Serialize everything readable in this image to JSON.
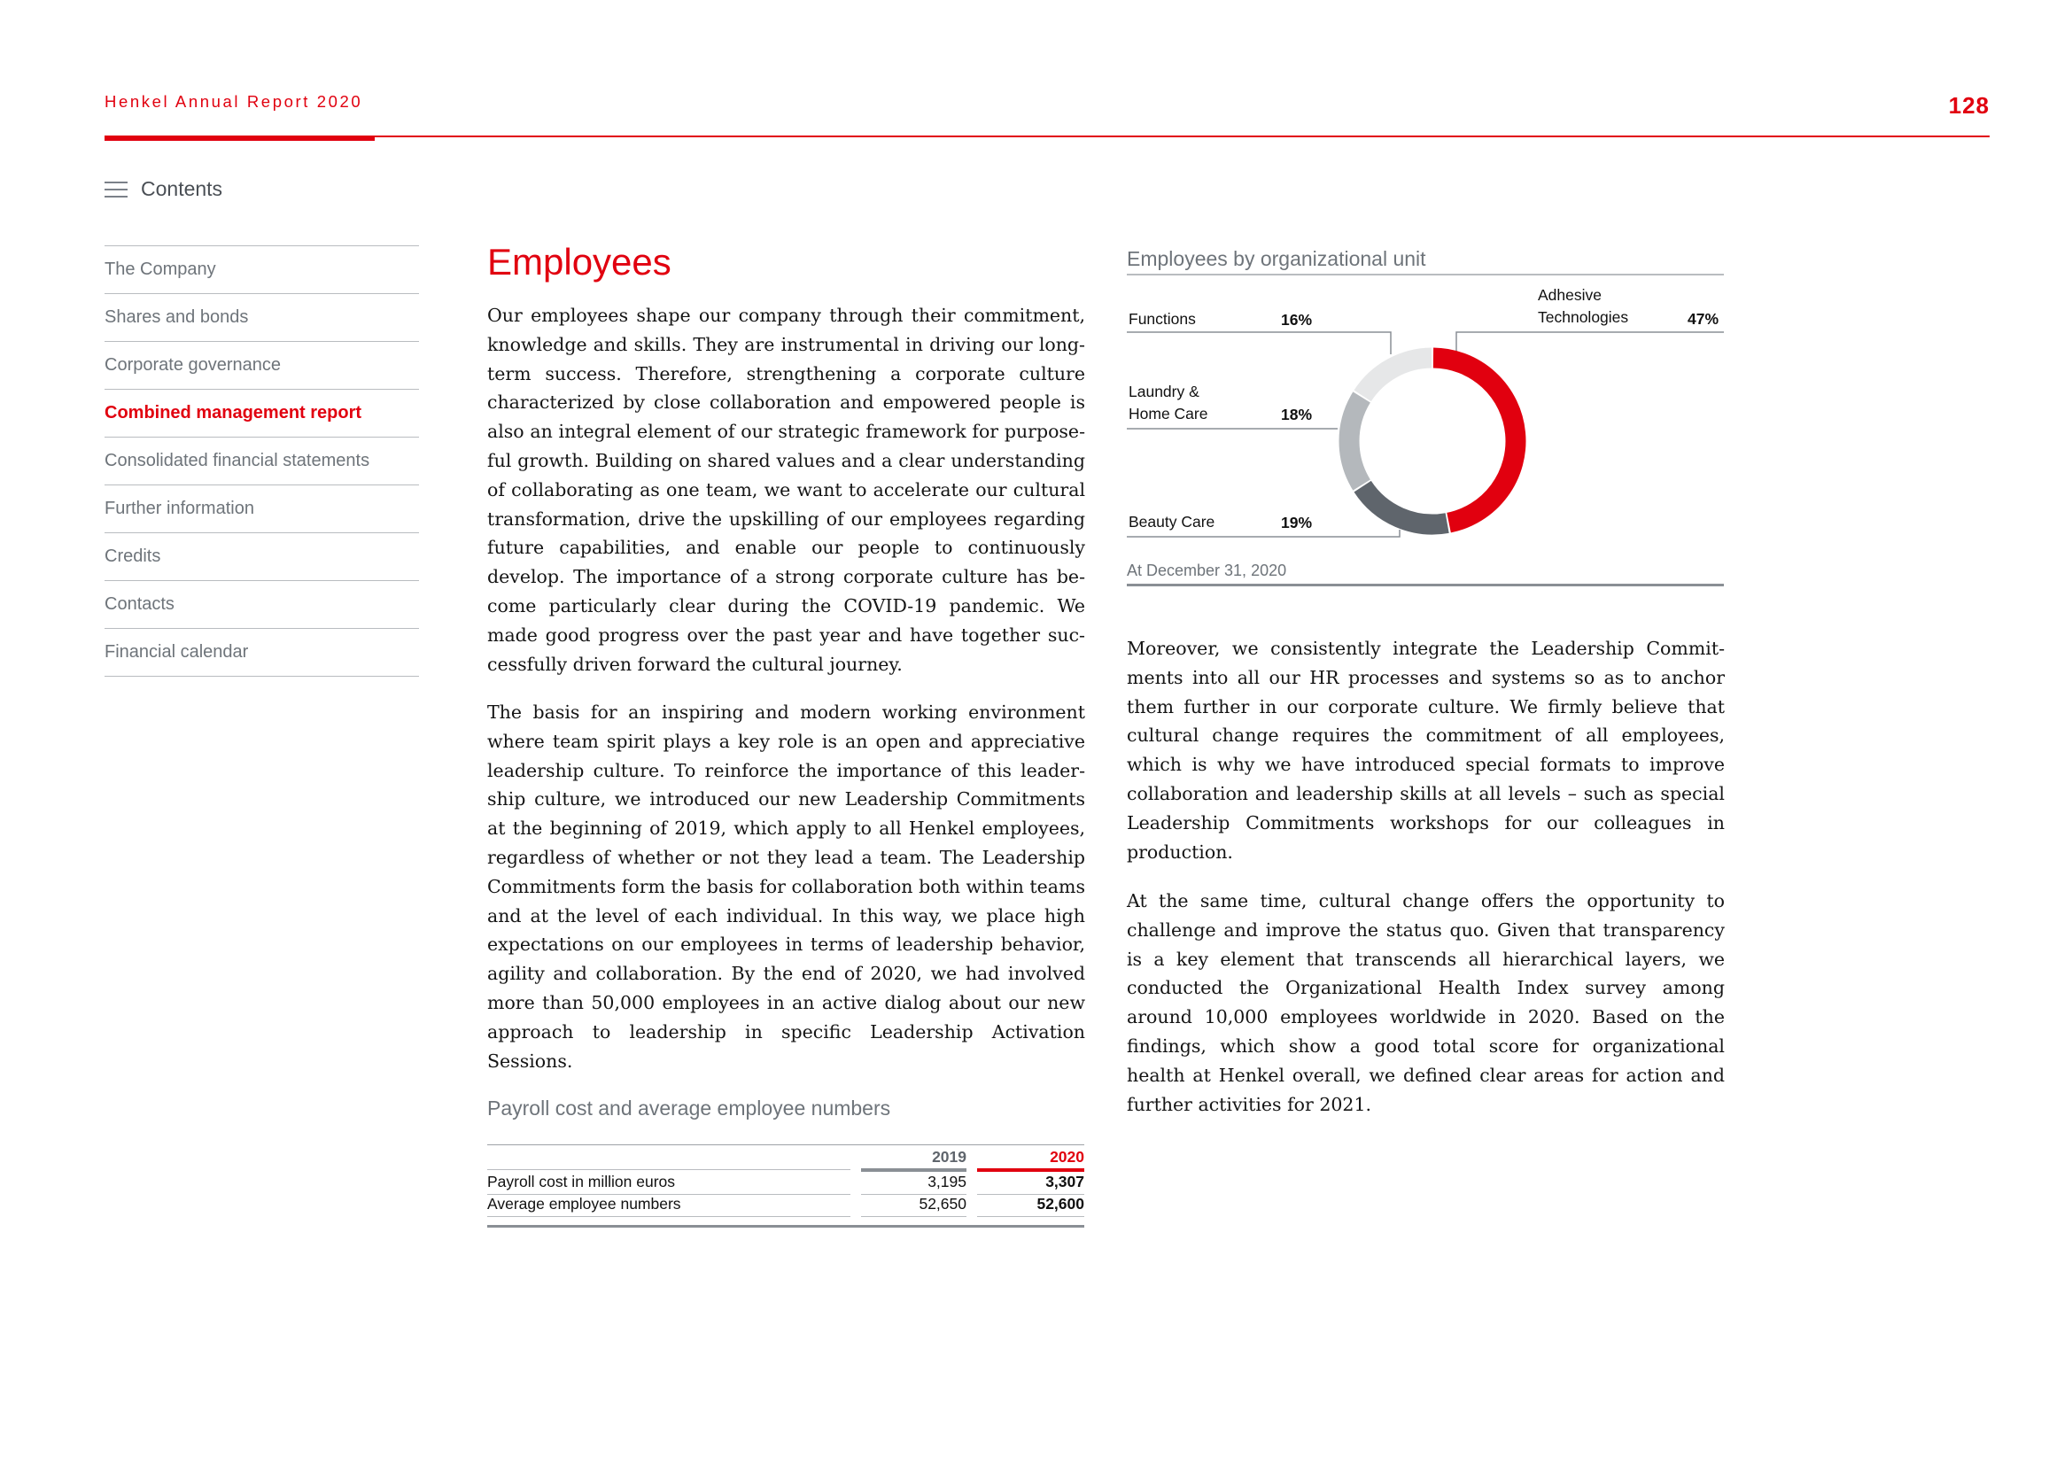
{
  "header": {
    "report_title": "Henkel Annual Report 2020",
    "page_number": "128"
  },
  "contents_link": {
    "label": "Contents",
    "icon": "menu-icon"
  },
  "sidebar": {
    "items": [
      {
        "label": "The Company",
        "active": false
      },
      {
        "label": "Shares and bonds",
        "active": false
      },
      {
        "label": "Corporate governance",
        "active": false
      },
      {
        "label": "Combined management report",
        "active": true
      },
      {
        "label": "Consolidated financial statements",
        "active": false
      },
      {
        "label": "Further information",
        "active": false
      },
      {
        "label": "Credits",
        "active": false
      },
      {
        "label": "Contacts",
        "active": false
      },
      {
        "label": "Financial calendar",
        "active": false
      }
    ]
  },
  "main": {
    "heading": "Employees",
    "paragraphs": [
      "Our employees shape our company through their commitment, knowledge and skills. They are instrumental in driving our long-term success. Therefore, strengthening a corporate culture characterized by close collaboration and empowered people is also an integral element of our strategic framework for purpose-ful growth. Building on shared values and a clear understanding of collaborating as one team, we want to accelerate our cultural transformation, drive the upskilling of our employees regarding future capabilities, and enable our people to continuously develop. The importance of a strong corporate culture has be-come particularly clear during the COVID-19 pandemic. We made good progress over the past year and have together suc-cessfully driven forward the cultural journey.",
      "The basis for an inspiring and modern working environment where team spirit plays a key role is an open and appreciative leadership culture. To reinforce the importance of this leader-ship culture, we introduced our new Leadership Commitments at the beginning of 2019, which apply to all Henkel employees, regardless of whether or not they lead a team. The Leadership Commitments form the basis for collaboration both within teams and at the level of each individual. In this way, we place high expectations on our employees in terms of leadership behavior, agility and collaboration. By the end of 2020, we had involved more than 50,000 employees in an active dialog about our new approach to leadership in specific Leadership Activation Sessions.",
      "Moreover, we consistently integrate the Leadership Commit-ments into all our HR processes and systems so as to anchor them further in our corporate culture. We firmly believe that cultural change requires the commitment of all employees, which is why we have introduced special formats to improve collaboration and leadership skills at all levels – such as special Leadership Commitments workshops for our colleagues in production.",
      "At the same time, cultural change offers the opportunity to challenge and improve the status quo. Given that transparency is a key element that transcends all hierarchical layers, we conducted the Organizational Health Index survey among around 10,000 employees worldwide in 2020. Based on the findings, which show a good total score for organizational health at Henkel overall, we defined clear areas for action and further activities for 2021."
    ]
  },
  "payroll_table": {
    "title": "Payroll cost and average employee numbers",
    "columns": [
      "",
      "2019",
      "2020"
    ],
    "rows": [
      {
        "label": "Payroll cost in million euros",
        "y2019": "3,195",
        "y2020": "3,307"
      },
      {
        "label": "Average employee numbers",
        "y2019": "52,650",
        "y2020": "52,600"
      }
    ]
  },
  "chart_data": {
    "type": "pie",
    "donut": true,
    "title": "Employees by organizational unit",
    "note": "At December 31, 2020",
    "slices": [
      {
        "label": "Adhesive Technologies",
        "value": 47,
        "display": "47%",
        "color": "#e1000f"
      },
      {
        "label": "Beauty Care",
        "value": 19,
        "display": "19%",
        "color": "#5f656c"
      },
      {
        "label": "Laundry & Home Care",
        "value": 18,
        "display": "18%",
        "color": "#b4b8bc"
      },
      {
        "label": "Functions",
        "value": 16,
        "display": "16%",
        "color": "#e6e7e8"
      }
    ],
    "label_lines": {
      "adhesive": [
        "Adhesive",
        "Technologies"
      ],
      "laundry": [
        "Laundry &",
        "Home Care"
      ],
      "beauty": [
        "Beauty Care"
      ],
      "functions": [
        "Functions"
      ]
    }
  },
  "colors": {
    "brand_red": "#e1000f",
    "gray_text": "#6e747a",
    "dark_gray": "#5f656c",
    "mid_gray": "#b4b8bc",
    "light_gray": "#e6e7e8"
  }
}
